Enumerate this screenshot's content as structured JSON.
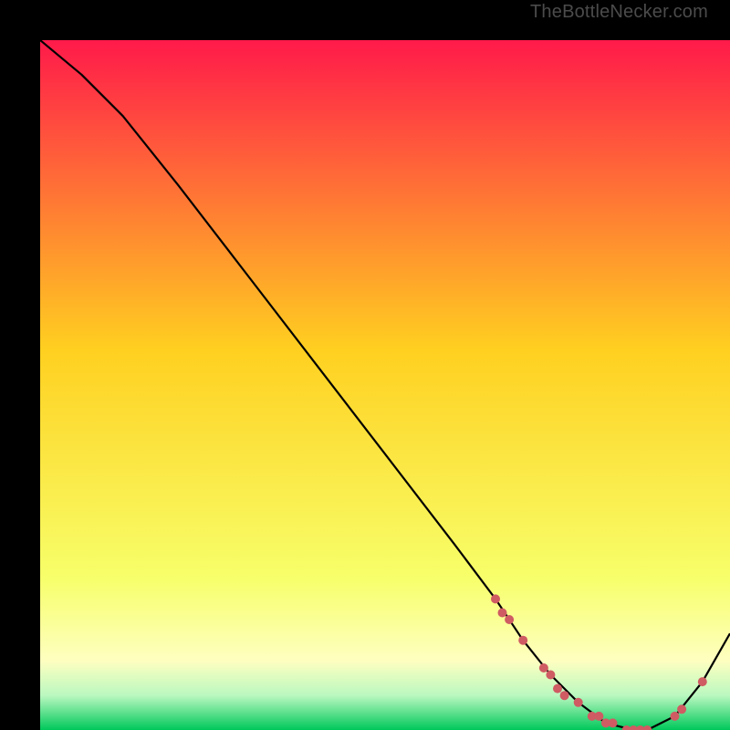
{
  "watermark": "TheBottleNecker.com",
  "colors": {
    "bg_black": "#000000",
    "gradient_top": "#ff1a4a",
    "gradient_mid": "#ffd020",
    "gradient_low": "#f7ff6a",
    "gradient_paleyellow": "#feffc0",
    "gradient_palegreen": "#baf8c0",
    "gradient_bottom": "#00c85a",
    "curve": "#000000",
    "marker": "#cf5b63"
  },
  "chart_data": {
    "type": "line",
    "title": "",
    "xlabel": "",
    "ylabel": "",
    "xlim": [
      0,
      100
    ],
    "ylim": [
      0,
      100
    ],
    "grid": false,
    "legend": false,
    "series": [
      {
        "name": "bottleneck-curve",
        "x": [
          0,
          6,
          12,
          20,
          30,
          40,
          50,
          60,
          66,
          70,
          74,
          78,
          82,
          86,
          88,
          92,
          96,
          100
        ],
        "y": [
          100,
          95,
          89,
          79,
          66,
          53,
          40,
          27,
          19,
          13,
          8,
          4,
          1,
          0,
          0,
          2,
          7,
          14
        ]
      }
    ],
    "markers": {
      "name": "highlight-points",
      "x": [
        66,
        67,
        68,
        70,
        73,
        74,
        75,
        76,
        78,
        80,
        81,
        82,
        83,
        85,
        86,
        87,
        88,
        92,
        93,
        96
      ],
      "y": [
        19,
        17,
        16,
        13,
        9,
        8,
        6,
        5,
        4,
        2,
        2,
        1,
        1,
        0,
        0,
        0,
        0,
        2,
        3,
        7
      ]
    }
  }
}
